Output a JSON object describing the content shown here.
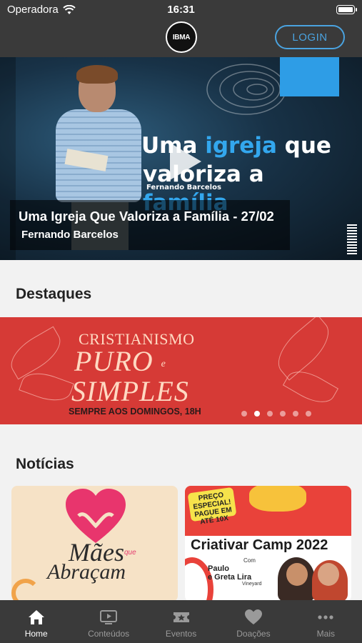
{
  "status": {
    "carrier": "Operadora",
    "time": "16:31"
  },
  "header": {
    "logo_text": "IBMA",
    "login_label": "LOGIN"
  },
  "hero": {
    "title_part1": "Uma ",
    "title_hl1": "igreja",
    "title_part2": " que",
    "title_part3": "valoriza a ",
    "title_hl2": "família",
    "subtitle": "Fernando Barcelos",
    "caption_title": "Uma Igreja Que Valoriza a Família - 27/02",
    "caption_author": "Fernando Barcelos"
  },
  "destaques": {
    "section_title": "Destaques",
    "banner": {
      "line1": "CRISTIANISMO",
      "line2": "PURO",
      "conj": "e",
      "line3": "SIMPLES",
      "line4": "SEMPRE AOS DOMINGOS, 18H"
    },
    "dots": 6,
    "active_dot": 1
  },
  "noticias": {
    "section_title": "Notícias",
    "cards": [
      {
        "line1": "Mães",
        "que": "que",
        "line2": "Abraçam"
      },
      {
        "badge": "PREÇO ESPECIAL! PAGUE EM ATÉ 10X",
        "title": "Criativar Camp 2022",
        "com": "Com",
        "names_1": "Paulo",
        "names_2": "e Greta Lira",
        "vineyard": "Vineyard"
      }
    ]
  },
  "tabbar": {
    "items": [
      {
        "label": "Home",
        "icon": "home-icon",
        "active": true
      },
      {
        "label": "Conteúdos",
        "icon": "tv-icon",
        "active": false
      },
      {
        "label": "Eventos",
        "icon": "ticket-icon",
        "active": false
      },
      {
        "label": "Doações",
        "icon": "heart-icon",
        "active": false
      },
      {
        "label": "Mais",
        "icon": "more-icon",
        "active": false
      }
    ]
  },
  "colors": {
    "accent": "#4aa3e0",
    "bar_bg": "#3a3a3a",
    "banner_red": "#d63a36"
  }
}
